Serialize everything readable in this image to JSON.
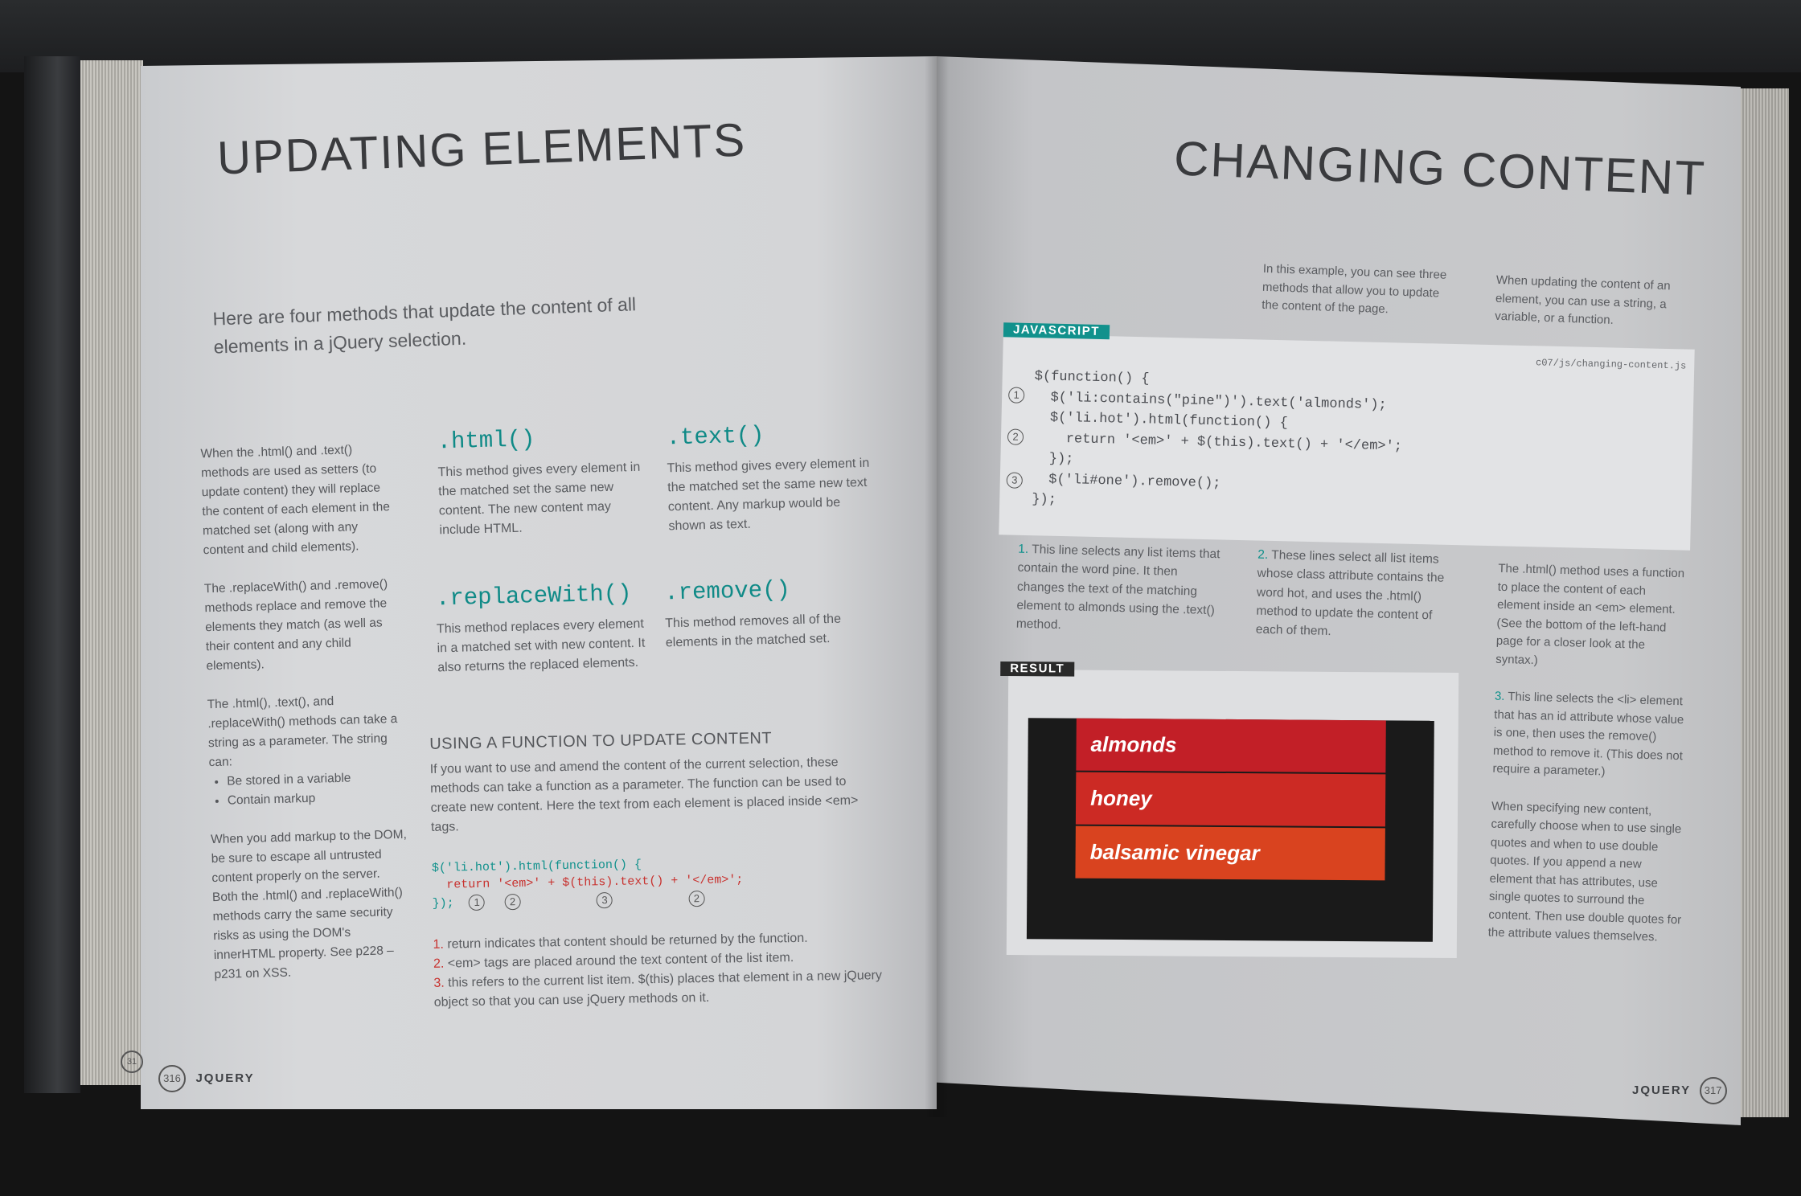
{
  "left_page": {
    "title": "UPDATING ELEMENTS",
    "intro": "Here are four methods that update the content of all elements in a jQuery selection.",
    "sidebar": {
      "p1": "When the .html() and .text() methods are used as setters (to update content) they will replace the content of each element in the matched set (along with any content and child elements).",
      "p2": "The .replaceWith() and .remove() methods replace and remove the elements they match (as well as their content and any child elements).",
      "p3": "The .html(), .text(), and .replaceWith() methods can take a string as a parameter. The string can:",
      "bullets": [
        "Be stored in a variable",
        "Contain markup"
      ],
      "p4": "When you add markup to the DOM, be sure to escape all untrusted content properly on the server. Both the .html() and .replaceWith() methods carry the same security risks as using the DOM's innerHTML property. See p228 – p231 on XSS."
    },
    "methods": [
      {
        "name": ".html()",
        "desc": "This method gives every element in the matched set the same new content. The new content may include HTML."
      },
      {
        "name": ".text()",
        "desc": "This method gives every element in the matched set the same new text content. Any markup would be shown as text."
      },
      {
        "name": ".replaceWith()",
        "desc": "This method replaces every element in a matched set with new content. It also returns the replaced elements."
      },
      {
        "name": ".remove()",
        "desc": "This method removes all of the elements in the matched set."
      }
    ],
    "function_section": {
      "heading": "USING A FUNCTION TO UPDATE CONTENT",
      "body": "If you want to use and amend the content of the current selection, these methods can take a function as a parameter. The function can be used to create new content. Here the text from each element is placed inside <em> tags.",
      "code_line1": "$('li.hot').html(function() {",
      "code_line2": "  return '<em>' + $(this).text() + '</em>';",
      "code_line3": "});",
      "markers": [
        "1",
        "2",
        "3",
        "2"
      ],
      "notes": [
        {
          "num": "1.",
          "text": "return indicates that content should be returned by the function."
        },
        {
          "num": "2.",
          "text": "<em> tags are placed around the text content of the list item."
        },
        {
          "num": "3.",
          "text": "this refers to the current list item. $(this) places that element in a new jQuery object so that you can use jQuery methods on it."
        }
      ]
    },
    "footer": {
      "page": "316",
      "section": "JQUERY",
      "prev_page": "31"
    }
  },
  "right_page": {
    "title": "CHANGING CONTENT",
    "intro1": "In this example, you can see three methods that allow you to update the content of the page.",
    "intro2": "When updating the content of an element, you can use a string, a variable, or a function.",
    "code": {
      "tag": "JAVASCRIPT",
      "filename": "c07/js/changing-content.js",
      "lines": [
        "$(function() {",
        "  $('li:contains(\"pine\")').text('almonds');",
        "  $('li.hot').html(function() {",
        "    return '<em>' + $(this).text() + '</em>';",
        "  });",
        "  $('li#one').remove();",
        "});"
      ],
      "markers": [
        "1",
        "2",
        "3"
      ]
    },
    "notes": [
      {
        "num": "1.",
        "text": "This line selects any list items that contain the word pine. It then changes the text of the matching element to almonds using the .text() method."
      },
      {
        "num": "2.",
        "text": "These lines select all list items whose class attribute contains the word hot, and uses the .html() method to update the content of each of them."
      }
    ],
    "side_notes": {
      "p1": "The .html() method uses a function to place the content of each element inside an <em> element. (See the bottom of the left-hand page for a closer look at the syntax.)",
      "p2_num": "3.",
      "p2": "This line selects the <li> element that has an id attribute whose value is one, then uses the remove() method to remove it. (This does not require a parameter.)",
      "p3": "When specifying new content, carefully choose when to use single quotes and when to use double quotes. If you append a new element that has attributes, use single quotes to surround the content. Then use double quotes for the attribute values themselves."
    },
    "result": {
      "tag": "RESULT",
      "items": [
        "almonds",
        "honey",
        "balsamic vinegar"
      ]
    },
    "footer": {
      "section": "JQUERY",
      "page": "317"
    }
  },
  "colors": {
    "teal": "#11918c",
    "red": "#c8322f",
    "item1": "#c21f27",
    "item2": "#cc2a24",
    "item3": "#d9431f"
  }
}
